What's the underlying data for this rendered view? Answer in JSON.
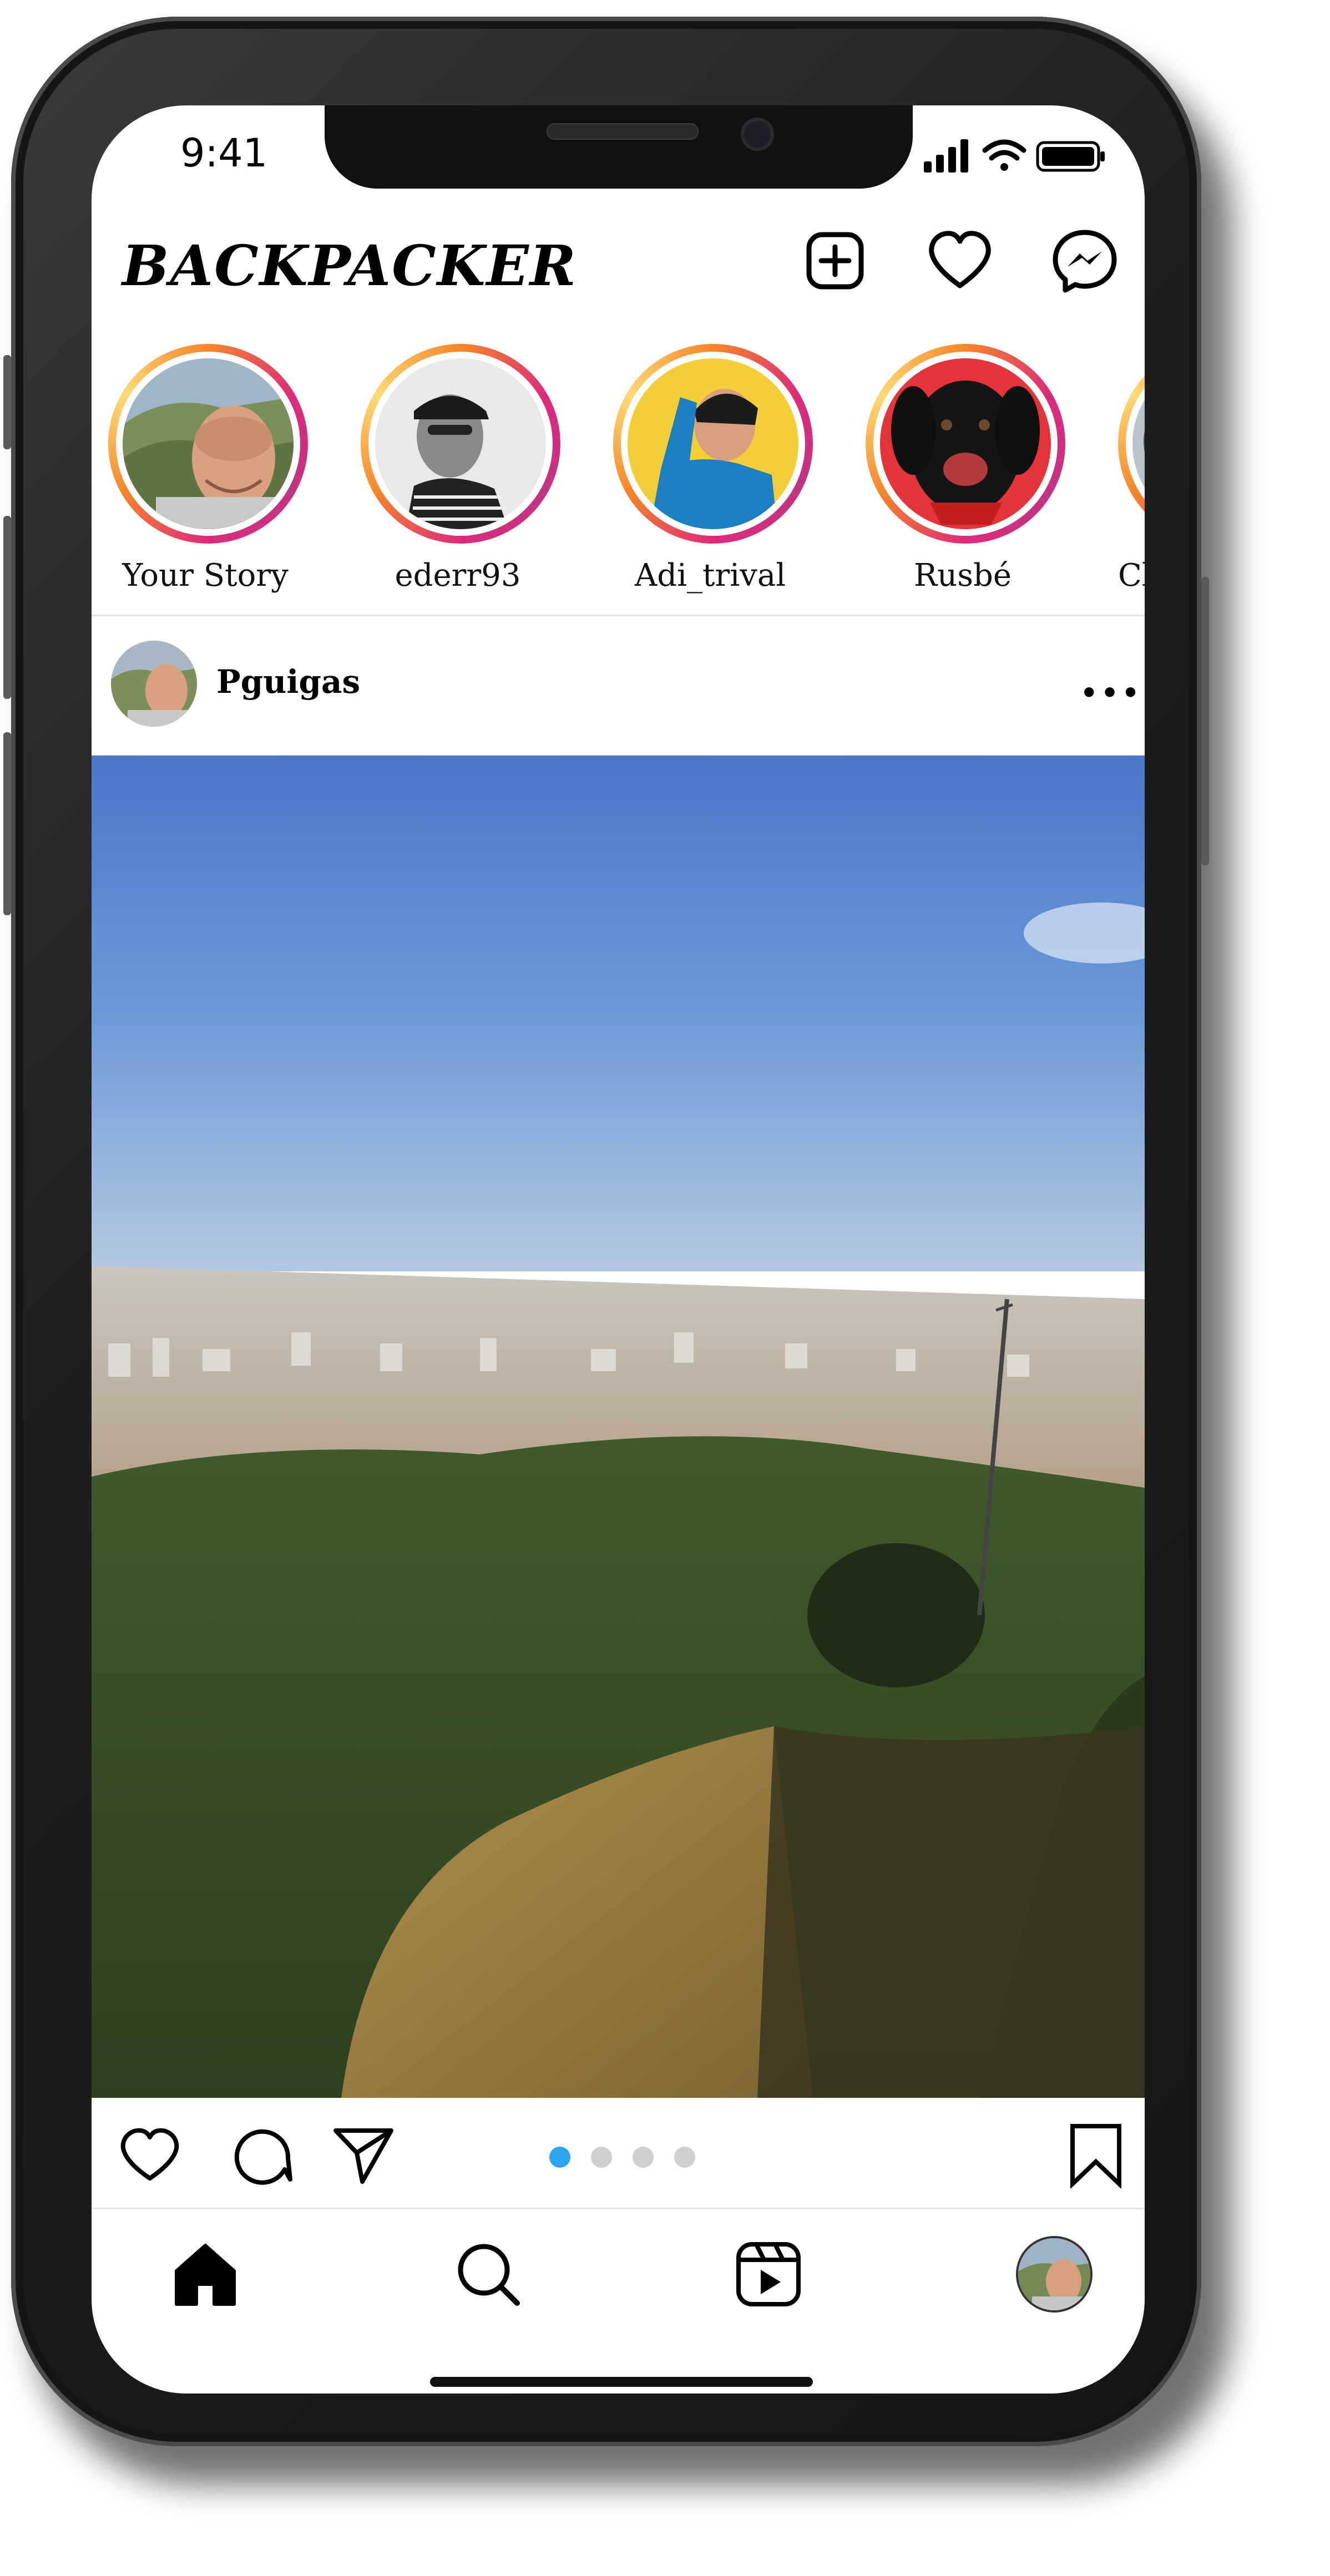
{
  "status_bar": {
    "time": "9:41"
  },
  "app": {
    "title": "BACKPACKER"
  },
  "stories": [
    {
      "label": "Your Story"
    },
    {
      "label": "ederr93"
    },
    {
      "label": "Adi_trival"
    },
    {
      "label": "Rusbé"
    },
    {
      "label": "Cl"
    }
  ],
  "post": {
    "username": "Pguigas",
    "more_label": "•••",
    "carousel": {
      "total": 4,
      "active_index": 1
    }
  },
  "icons": {
    "header": [
      "add-post-icon",
      "heart-icon",
      "messenger-icon"
    ],
    "actions": [
      "like-icon",
      "comment-icon",
      "share-icon",
      "bookmark-icon"
    ],
    "nav": [
      "home-icon",
      "search-icon",
      "reels-icon",
      "profile-avatar"
    ]
  },
  "colors": {
    "story_ring_start": "#f58529",
    "story_ring_end": "#dd2a7b",
    "carousel_active": "#2aa4ee",
    "carousel_inactive": "#cfcfcf"
  }
}
